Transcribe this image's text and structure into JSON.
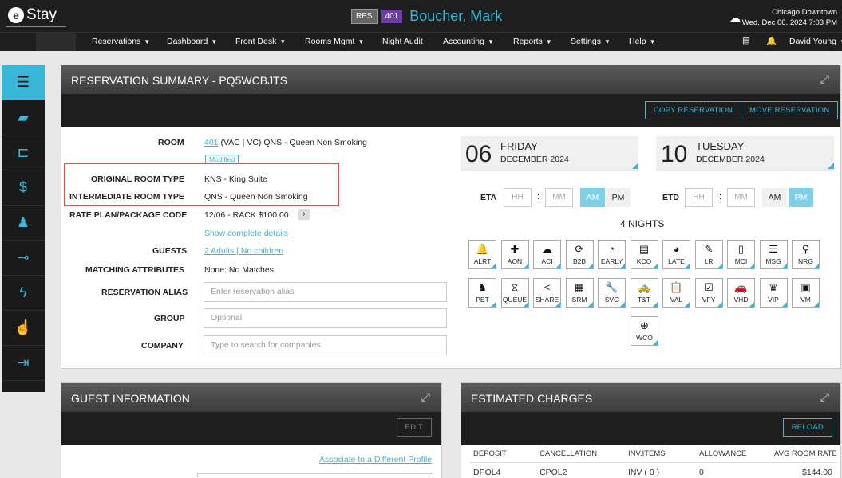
{
  "app": {
    "logo_text": "Stay",
    "logo_letter": "e"
  },
  "header": {
    "res_badge": "RES",
    "room_badge": "401",
    "guest_name": "Boucher, Mark",
    "hotel": "Chicago Downtown",
    "datetime": "Wed, Dec 06, 2024 7:03 PM"
  },
  "nav": {
    "items": [
      "Reservations",
      "Dashboard",
      "Front Desk",
      "Rooms Mgmt",
      "Night Audit",
      "Accounting",
      "Reports",
      "Settings",
      "Help"
    ],
    "user": "David Young"
  },
  "reservation": {
    "title": "RESERVATION SUMMARY - PQ5WCBJTS",
    "copy_button": "COPY RESERVATION",
    "move_button": "MOVE RESERVATION",
    "labels": {
      "room": "ROOM",
      "original_room_type": "ORIGINAL ROOM TYPE",
      "intermediate_room_type": "INTERMEDIATE ROOM TYPE",
      "rate_plan": "RATE PLAN/PACKAGE CODE",
      "guests": "GUESTS",
      "matching_attributes": "MATCHING ATTRIBUTES",
      "alias": "RESERVATION ALIAS",
      "group": "GROUP",
      "company": "COMPANY"
    },
    "room_number": "401",
    "room_detail": "(VAC | VC) QNS - Queen Non Smoking",
    "modified": "Modified",
    "original_room_type": "KNS - King Suite",
    "intermediate_room_type": "QNS - Queen Non Smoking",
    "rate_plan": "12/06 - RACK $100.00",
    "show_details": "Show complete details",
    "guests": "2 Adults | No children",
    "matching_attributes": "None: No Matches",
    "alias_placeholder": "Enter reservation alias",
    "group_placeholder": "Optional",
    "company_placeholder": "Type to search for companies",
    "arrival": {
      "day": "06",
      "weekday": "FRIDAY",
      "month": "DECEMBER 2024"
    },
    "departure": {
      "day": "10",
      "weekday": "TUESDAY",
      "month": "DECEMBER 2024"
    },
    "eta_label": "ETA",
    "etd_label": "ETD",
    "hh": "HH",
    "mm": "MM",
    "am": "AM",
    "pm": "PM",
    "eta_selected": "AM",
    "etd_selected": "PM",
    "nights": "4 NIGHTS",
    "icon_buttons": [
      {
        "label": "ALRT",
        "icon": "bell-icon",
        "glyph": "🔔"
      },
      {
        "label": "AON",
        "icon": "puzzle-icon",
        "glyph": "✚"
      },
      {
        "label": "ACI",
        "icon": "cloud-check-icon",
        "glyph": "☁"
      },
      {
        "label": "B2B",
        "icon": "refresh-icon",
        "glyph": "⟳"
      },
      {
        "label": "EARLY",
        "icon": "clock-left-icon",
        "glyph": "◔"
      },
      {
        "label": "KCO",
        "icon": "doc-clock-icon",
        "glyph": "▤"
      },
      {
        "label": "LATE",
        "icon": "clock-right-icon",
        "glyph": "◕"
      },
      {
        "label": "LR",
        "icon": "pen-icon",
        "glyph": "✎"
      },
      {
        "label": "MCI",
        "icon": "mobile-icon",
        "glyph": "▯"
      },
      {
        "label": "MSG",
        "icon": "message-icon",
        "glyph": "☰"
      },
      {
        "label": "NRG",
        "icon": "person-off-icon",
        "glyph": "⚲"
      },
      {
        "label": "PET",
        "icon": "dog-icon",
        "glyph": "♞"
      },
      {
        "label": "QUEUE",
        "icon": "queue-icon",
        "glyph": "⧖"
      },
      {
        "label": "SHARE",
        "icon": "share-icon",
        "glyph": "<"
      },
      {
        "label": "SRM",
        "icon": "calendar-clock-icon",
        "glyph": "▦"
      },
      {
        "label": "SVC",
        "icon": "wrench-icon",
        "glyph": "🔧"
      },
      {
        "label": "T&T",
        "icon": "taxi-icon",
        "glyph": "🚕"
      },
      {
        "label": "VAL",
        "icon": "clipboard-icon",
        "glyph": "📋"
      },
      {
        "label": "VFY",
        "icon": "id-check-icon",
        "glyph": "☑"
      },
      {
        "label": "VHD",
        "icon": "car-icon",
        "glyph": "🚗"
      },
      {
        "label": "VIP",
        "icon": "crown-icon",
        "glyph": "♛"
      },
      {
        "label": "VM",
        "icon": "voicemail-icon",
        "glyph": "▣"
      },
      {
        "label": "WCO",
        "icon": "globe-icon",
        "glyph": "⊕"
      }
    ]
  },
  "guest_info": {
    "title": "GUEST INFORMATION",
    "edit": "EDIT",
    "associate_link": "Associate to a Different Profile"
  },
  "charges": {
    "title": "ESTIMATED CHARGES",
    "reload": "RELOAD",
    "columns": [
      "DEPOSIT",
      "CANCELLATION",
      "INV.ITEMS",
      "ALLOWANCE",
      "AVG ROOM RATE"
    ],
    "row": [
      "DPOL4",
      "CPOL2",
      "INV ( 0 )",
      "0",
      "$144.00"
    ]
  },
  "colors": {
    "accent": "#3ab6d8",
    "header": "#1e1e1e",
    "highlight": "#d9534f",
    "room_badge": "#6b3fa0"
  }
}
